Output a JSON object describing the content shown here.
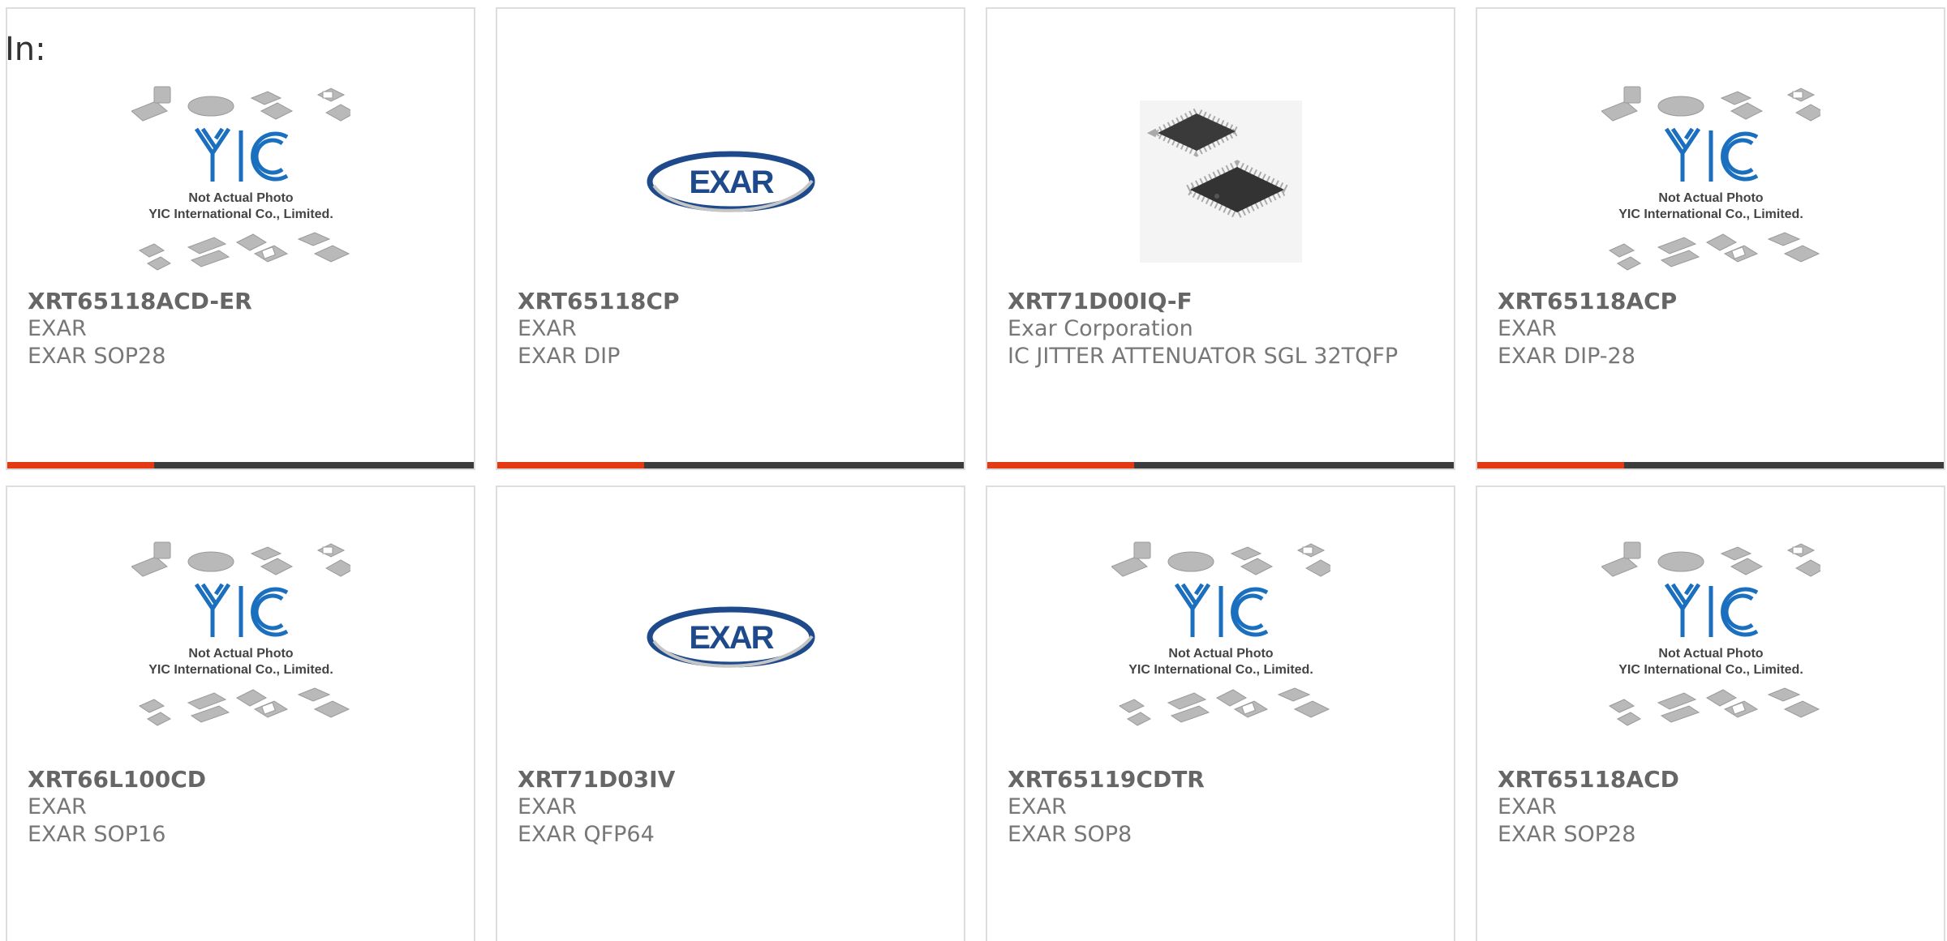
{
  "header": {
    "in_label": "In:"
  },
  "placeholder": {
    "line1": "Not Actual Photo",
    "line2": "YIC International Co., Limited.",
    "logo": "YIC"
  },
  "exar_logo_text": "EXAR",
  "colors": {
    "accent": "#e43a14",
    "bar": "#3c3c3c",
    "yic_blue": "#1b6fbf",
    "exar_blue": "#1e4a8c"
  },
  "products": [
    {
      "part": "XRT65118ACD-ER",
      "maker": "EXAR",
      "desc": "EXAR SOP28",
      "image": "yic-placeholder"
    },
    {
      "part": "XRT65118CP",
      "maker": "EXAR",
      "desc": "EXAR DIP",
      "image": "exar-logo"
    },
    {
      "part": "XRT71D00IQ-F",
      "maker": "Exar Corporation",
      "desc": "IC JITTER ATTENUATOR SGL 32TQFP",
      "image": "tqfp-chip-photo"
    },
    {
      "part": "XRT65118ACP",
      "maker": "EXAR",
      "desc": "EXAR DIP-28",
      "image": "yic-placeholder"
    },
    {
      "part": "XRT66L100CD",
      "maker": "EXAR",
      "desc": "EXAR SOP16",
      "image": "yic-placeholder"
    },
    {
      "part": "XRT71D03IV",
      "maker": "EXAR",
      "desc": "EXAR QFP64",
      "image": "exar-logo"
    },
    {
      "part": "XRT65119CDTR",
      "maker": "EXAR",
      "desc": "EXAR SOP8",
      "image": "yic-placeholder"
    },
    {
      "part": "XRT65118ACD",
      "maker": "EXAR",
      "desc": "EXAR SOP28",
      "image": "yic-placeholder"
    }
  ]
}
